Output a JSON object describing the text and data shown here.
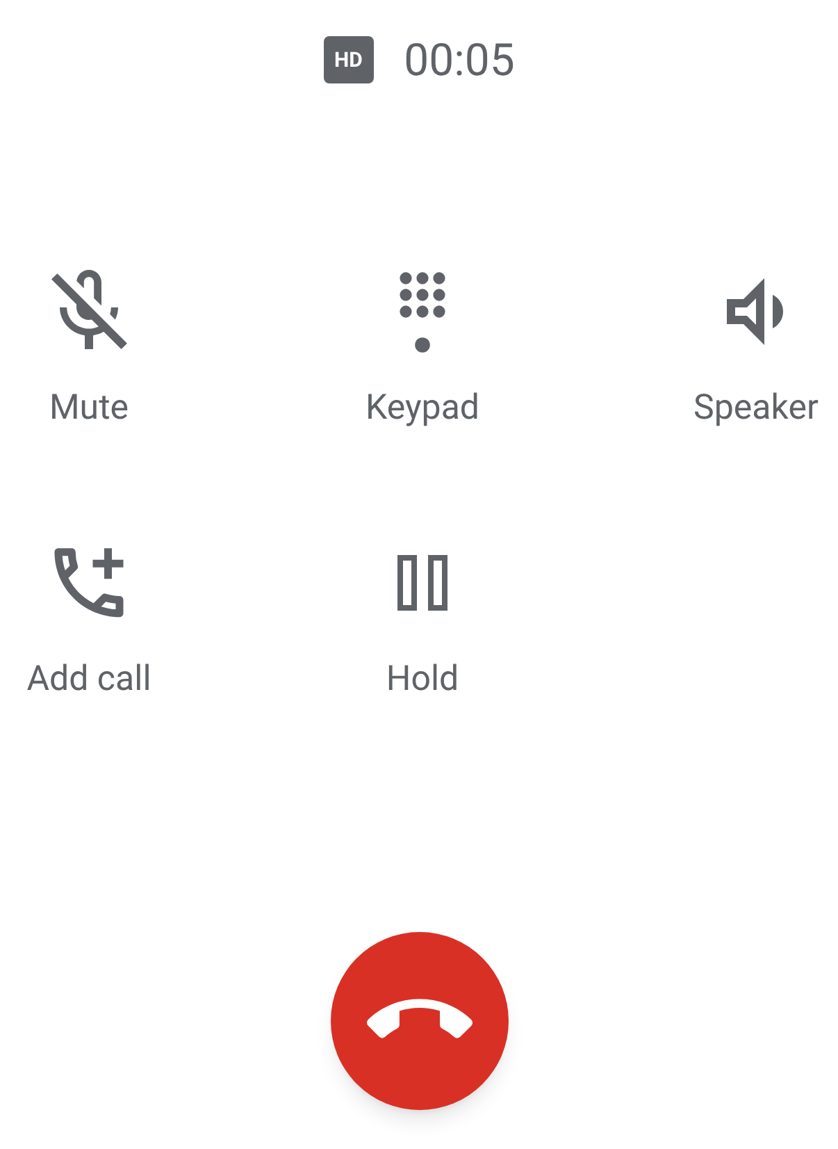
{
  "call": {
    "badge": "HD",
    "timer": "00:05"
  },
  "actions": [
    {
      "kind": "mute",
      "label": "Mute"
    },
    {
      "kind": "keypad",
      "label": "Keypad"
    },
    {
      "kind": "speaker",
      "label": "Speaker"
    },
    {
      "kind": "add_call",
      "label": "Add call"
    },
    {
      "kind": "hold",
      "label": "Hold"
    }
  ]
}
